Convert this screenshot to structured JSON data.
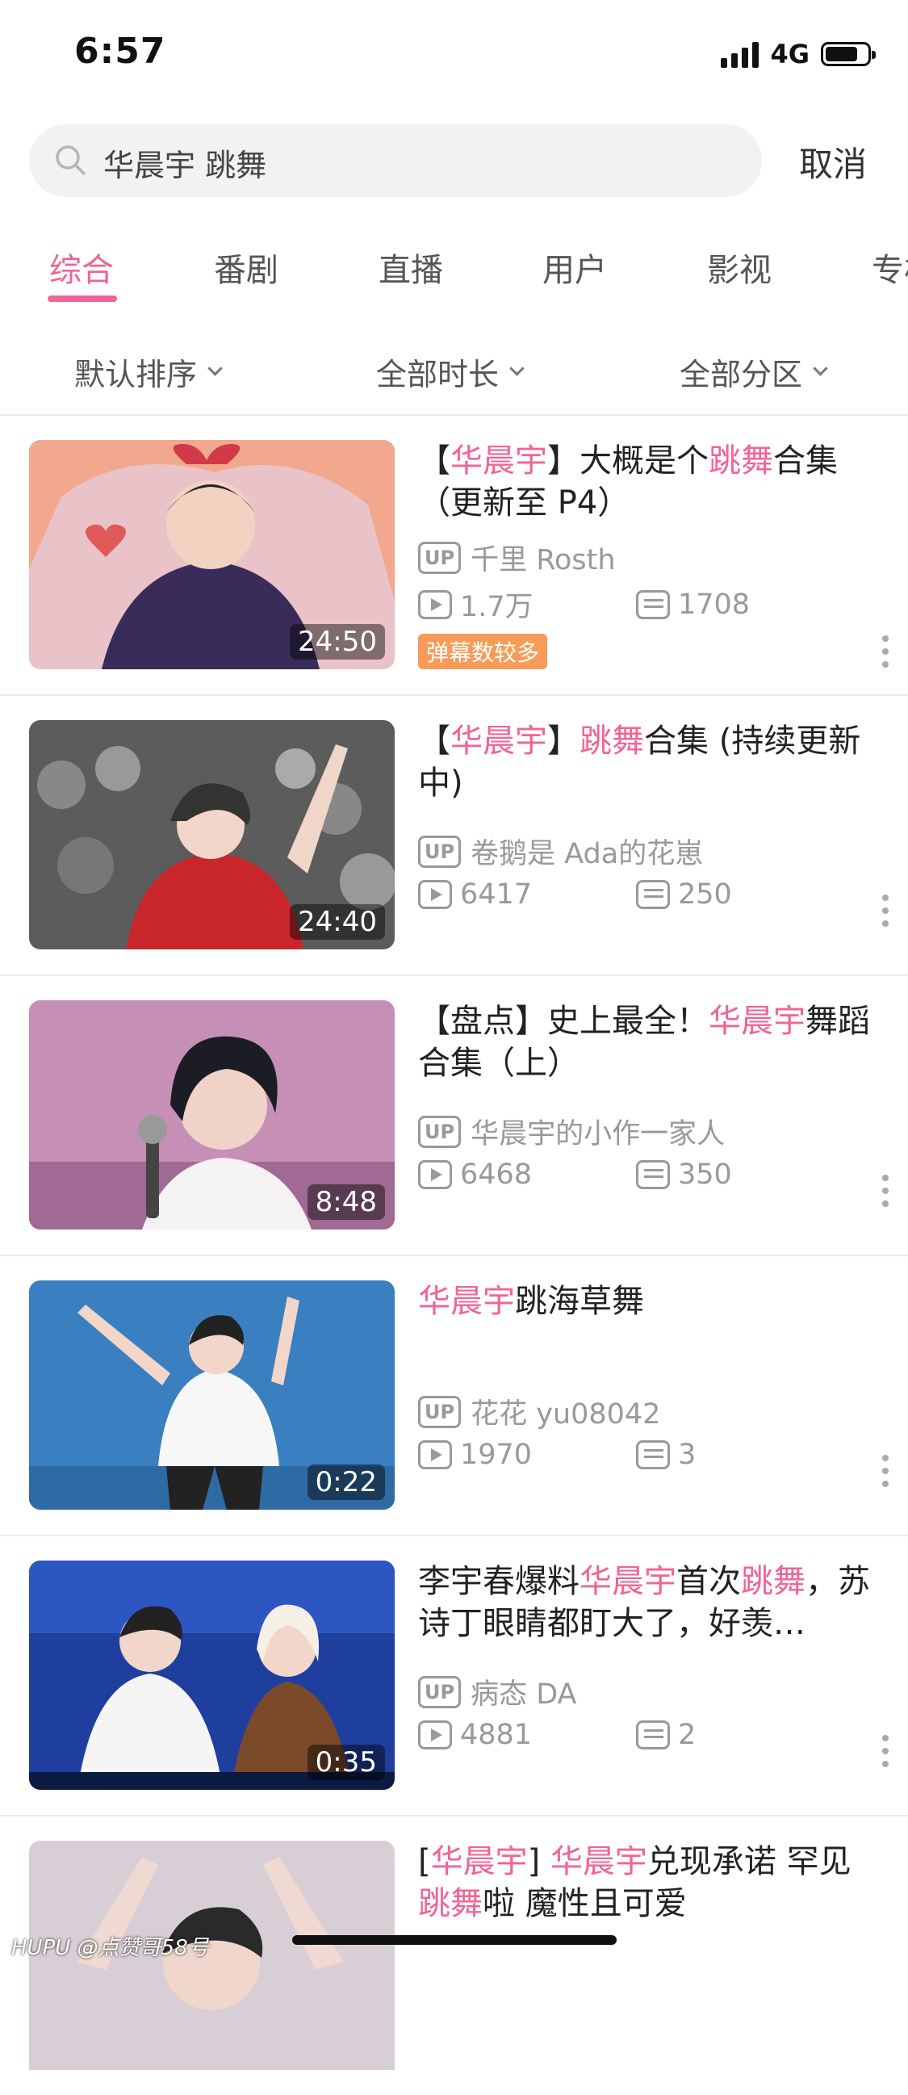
{
  "status": {
    "time": "6:57",
    "network": "4G"
  },
  "search": {
    "query": "华晨宇  跳舞",
    "cancel": "取消"
  },
  "tabs": [
    "综合",
    "番剧",
    "直播",
    "用户",
    "影视",
    "专栏"
  ],
  "filters": [
    "默认排序",
    "全部时长",
    "全部分区"
  ],
  "results": [
    {
      "title_parts": [
        [
          "【",
          ""
        ],
        [
          "华晨宇",
          "hl"
        ],
        [
          "】大概是个",
          ""
        ],
        [
          "跳舞",
          "hl"
        ],
        [
          "合集（更新至 P4）",
          ""
        ]
      ],
      "up": "千里 Rosth",
      "plays": "1.7万",
      "danmaku": "1708",
      "duration": "24:50",
      "badge": "弹幕数较多"
    },
    {
      "title_parts": [
        [
          "【",
          ""
        ],
        [
          "华晨宇",
          "hl"
        ],
        [
          "】",
          ""
        ],
        [
          "跳舞",
          "hl"
        ],
        [
          "合集 (持续更新中)",
          ""
        ]
      ],
      "up": "卷鹅是 Ada的花崽",
      "plays": "6417",
      "danmaku": "250",
      "duration": "24:40"
    },
    {
      "title_parts": [
        [
          "【盘点】史上最全！",
          ""
        ],
        [
          "华晨宇",
          "hl"
        ],
        [
          "舞蹈合集（上）",
          ""
        ]
      ],
      "up": "华晨宇的小作一家人",
      "plays": "6468",
      "danmaku": "350",
      "duration": "8:48"
    },
    {
      "title_parts": [
        [
          "华晨宇",
          "hl"
        ],
        [
          "跳海草舞",
          ""
        ]
      ],
      "up": "花花 yu08042",
      "plays": "1970",
      "danmaku": "3",
      "duration": "0:22"
    },
    {
      "title_parts": [
        [
          "李宇春爆料",
          ""
        ],
        [
          "华晨宇",
          "hl"
        ],
        [
          "首次",
          ""
        ],
        [
          "跳舞",
          "hl"
        ],
        [
          "，苏诗丁眼睛都盯大了，好羡…",
          ""
        ]
      ],
      "up": "病态 DA",
      "plays": "4881",
      "danmaku": "2",
      "duration": "0:35"
    },
    {
      "title_parts": [
        [
          "[",
          ""
        ],
        [
          "华晨宇",
          "hl"
        ],
        [
          "] ",
          ""
        ],
        [
          "华晨宇",
          "hl"
        ],
        [
          "兑现承诺 罕见",
          ""
        ],
        [
          "跳舞",
          "hl"
        ],
        [
          "啦  魔性且可爱",
          ""
        ]
      ],
      "up": "",
      "plays": "",
      "danmaku": "",
      "duration": ""
    }
  ],
  "watermark": "HUPU @点赞哥58号",
  "colors": {
    "accent": "#f06595",
    "badge": "#f79b58"
  }
}
